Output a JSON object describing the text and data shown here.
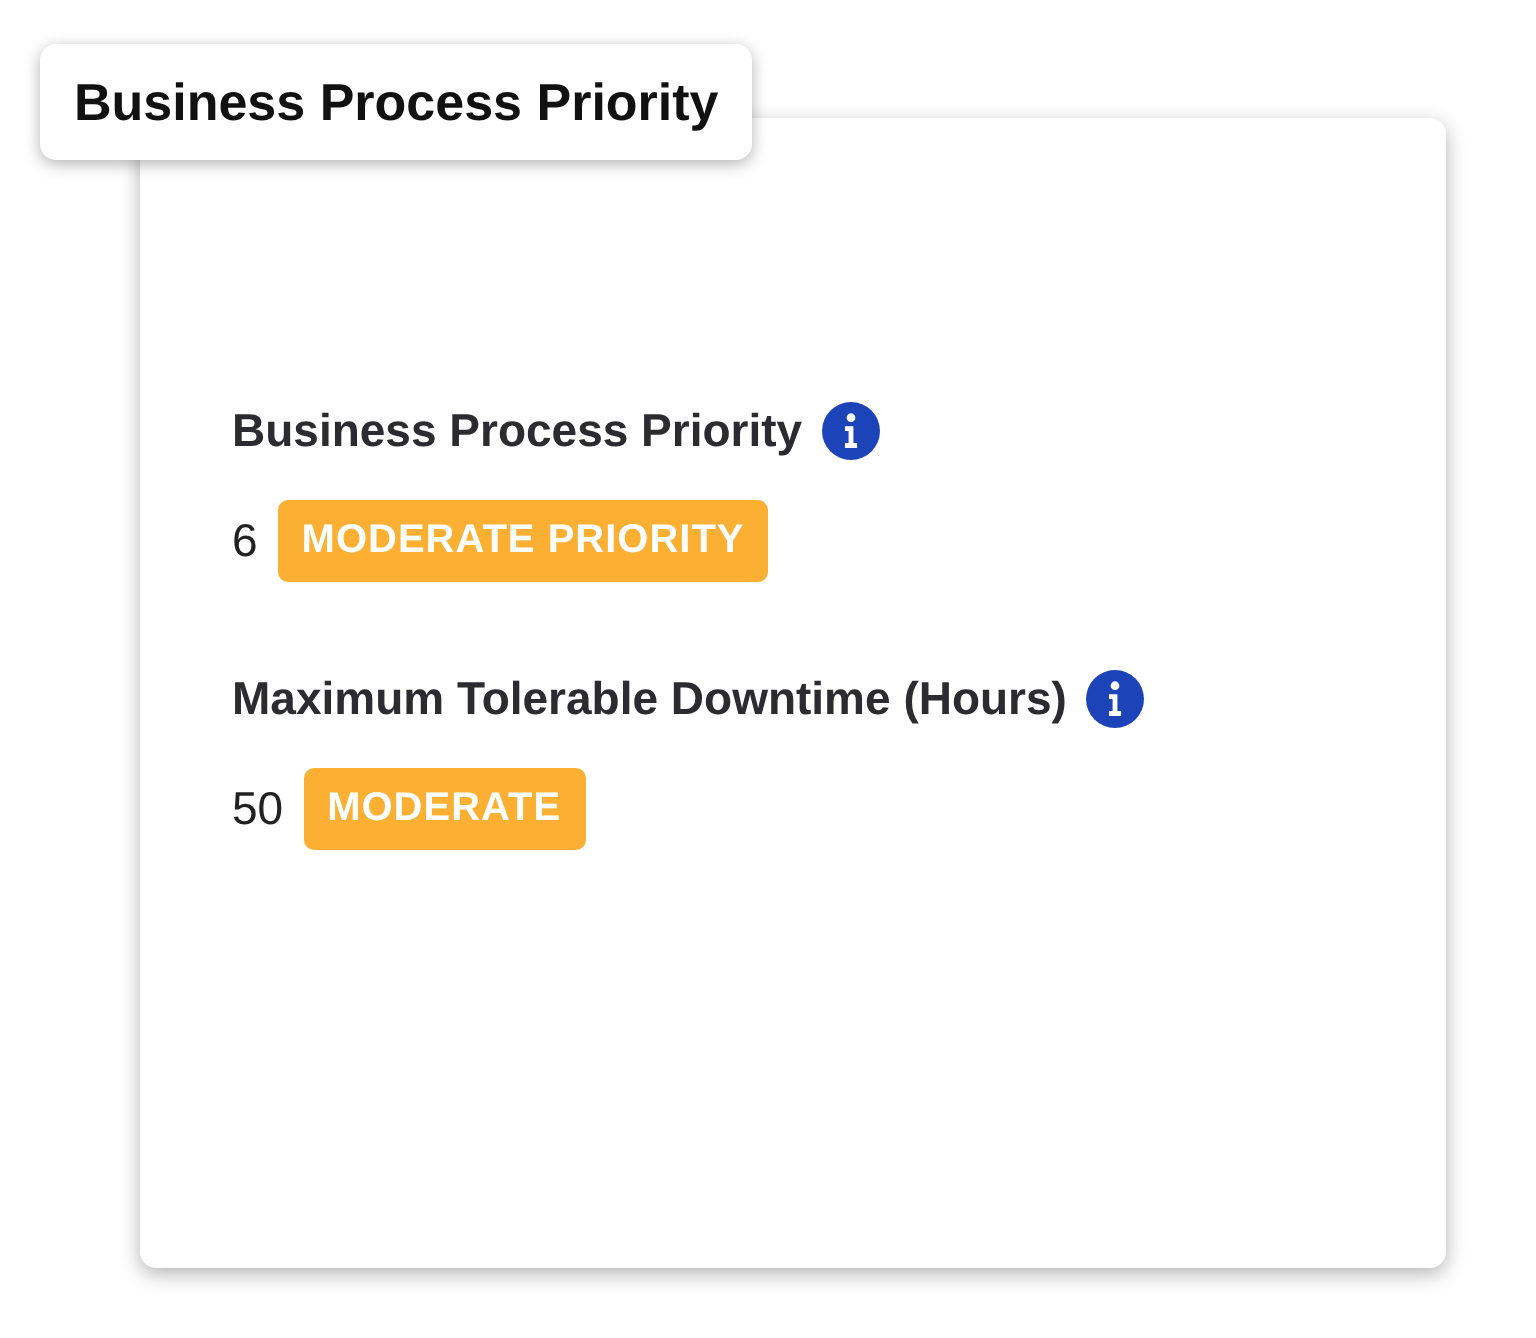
{
  "title": "Business Process Priority",
  "fields": [
    {
      "label": "Business Process Priority",
      "value": "6",
      "badge": "MODERATE PRIORITY"
    },
    {
      "label": "Maximum Tolerable Downtime (Hours)",
      "value": "50",
      "badge": "MODERATE"
    }
  ]
}
